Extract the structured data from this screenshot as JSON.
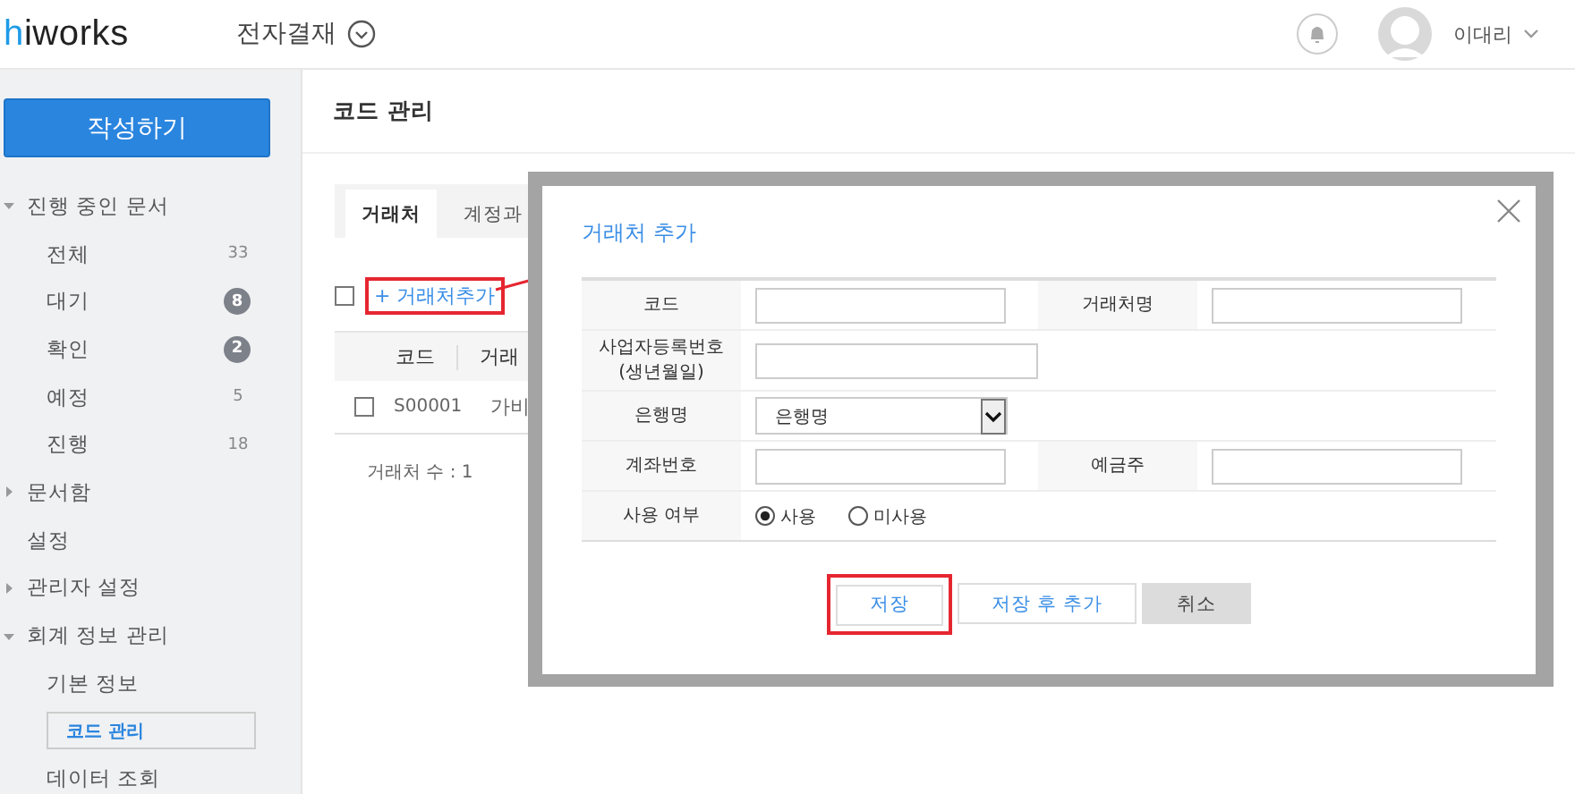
{
  "header": {
    "logo": "hiworks",
    "app_title": "전자결재",
    "user_name": "이대리"
  },
  "sidebar": {
    "compose_button": "작성하기",
    "items": [
      {
        "label": "진행 중인 문서",
        "expanded": true,
        "children": [
          {
            "label": "전체",
            "count": "33",
            "kind": "plain",
            "selected": false
          },
          {
            "label": "대기",
            "count": "8",
            "kind": "badge",
            "selected": false
          },
          {
            "label": "확인",
            "count": "2",
            "kind": "badge",
            "selected": false
          },
          {
            "label": "예정",
            "count": "5",
            "kind": "plain",
            "selected": false
          },
          {
            "label": "진행",
            "count": "18",
            "kind": "plain",
            "selected": false
          }
        ]
      },
      {
        "label": "문서함",
        "expanded": false
      },
      {
        "label": "설정"
      },
      {
        "label": "관리자 설정",
        "expanded": false
      },
      {
        "label": "회계 정보 관리",
        "expanded": true,
        "children": [
          {
            "label": "기본 정보",
            "selected": false
          },
          {
            "label": "코드 관리",
            "selected": true
          },
          {
            "label": "데이터 조회",
            "selected": false
          }
        ]
      }
    ]
  },
  "page": {
    "title": "코드 관리",
    "tabs": [
      {
        "label": "거래처",
        "selected": true
      },
      {
        "label": "계정과",
        "selected": false
      }
    ],
    "select_all": {
      "checked": false
    },
    "add_link": "+ 거래처추가",
    "table": {
      "columns": [
        "코드",
        "거래"
      ],
      "rows": [
        {
          "checked": false,
          "cells": [
            "S00001",
            "가비"
          ]
        }
      ]
    },
    "count_text": "거래처 수 : 1"
  },
  "modal": {
    "title": "거래처 추가",
    "rows": [
      {
        "fields": [
          {
            "label": "코드",
            "kind": "input"
          },
          {
            "label": "거래처명",
            "kind": "input"
          }
        ]
      },
      {
        "fields": [
          {
            "label": "사업자등록번호\n(생년월일)",
            "kind": "input"
          }
        ]
      },
      {
        "fields": [
          {
            "label": "은행명",
            "kind": "select",
            "value": "은행명"
          }
        ]
      },
      {
        "fields": [
          {
            "label": "계좌번호",
            "kind": "input"
          },
          {
            "label": "예금주",
            "kind": "input"
          }
        ]
      },
      {
        "fields": [
          {
            "label": "사용 여부",
            "kind": "radio",
            "options": [
              {
                "label": "사용",
                "selected": true
              },
              {
                "label": "미사용",
                "selected": false
              }
            ]
          }
        ]
      }
    ],
    "buttons": [
      {
        "label": "저장",
        "kind": "primary",
        "highlighted": true
      },
      {
        "label": "저장 후 추가",
        "kind": "primary",
        "highlighted": false
      },
      {
        "label": "취소",
        "kind": "cancel",
        "highlighted": false
      }
    ]
  }
}
